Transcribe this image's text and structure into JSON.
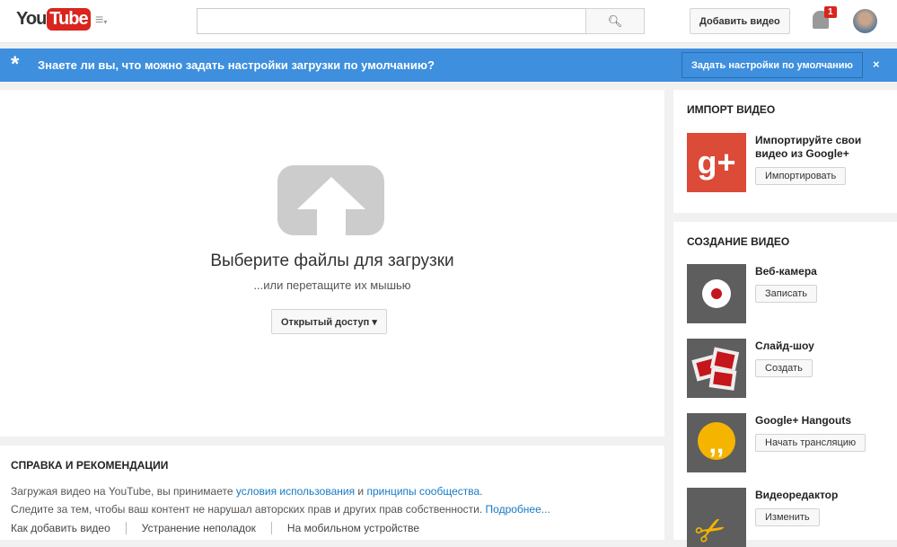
{
  "header": {
    "logo_you": "You",
    "logo_tube": "Tube",
    "search_placeholder": "",
    "add_video": "Добавить видео",
    "notifications": "1"
  },
  "banner": {
    "message": "Знаете ли вы, что можно задать настройки загрузки по умолчанию?",
    "button": "Задать настройки по умолчанию",
    "close": "×"
  },
  "upload": {
    "title": "Выберите файлы для загрузки",
    "subtitle": "...или перетащите их мышью",
    "privacy": "Открытый доступ ▾"
  },
  "help": {
    "title": "СПРАВКА И РЕКОМЕНДАЦИИ",
    "line1_a": "Загружая видео на YouTube, вы принимаете ",
    "terms": "условия использования",
    "and": " и ",
    "guidelines": "принципы сообщества",
    "dot": ".",
    "line2": "Следите за тем, чтобы ваш контент не нарушал авторских прав и других прав собственности. ",
    "more": "Подробнее...",
    "links": [
      "Как добавить видео",
      "Устранение неполадок",
      "На мобильном устройстве"
    ]
  },
  "import": {
    "title": "ИМПОРТ ВИДЕО",
    "text": "Импортируйте свои видео из Google+",
    "button": "Импортировать"
  },
  "create": {
    "title": "СОЗДАНИЕ ВИДЕО",
    "items": [
      {
        "label": "Веб-камера",
        "button": "Записать"
      },
      {
        "label": "Слайд-шоу",
        "button": "Создать"
      },
      {
        "label": "Google+ Hangouts",
        "button": "Начать трансляцию"
      },
      {
        "label": "Видеоредактор",
        "button": "Изменить"
      }
    ]
  }
}
